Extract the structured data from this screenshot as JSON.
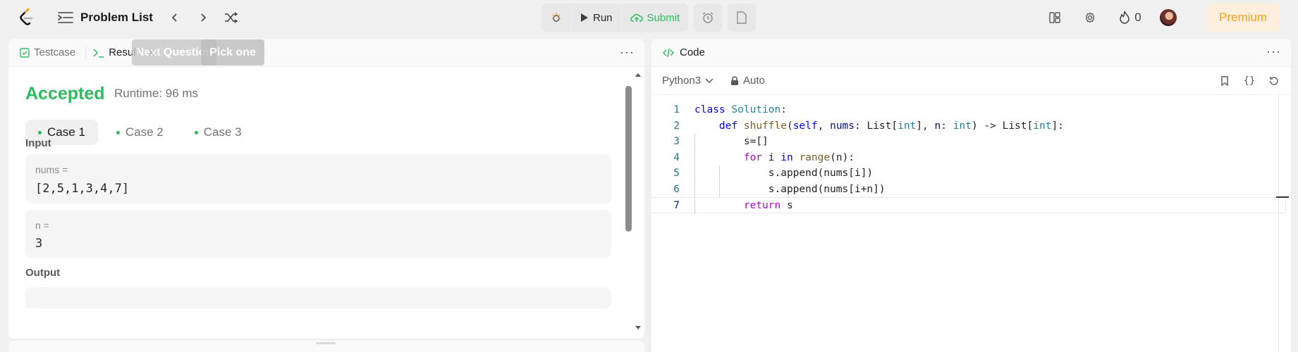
{
  "nav": {
    "problem_list": "Problem List",
    "run": "Run",
    "submit": "Submit",
    "fire_count": "0",
    "premium": "Premium"
  },
  "left": {
    "tabs": [
      "Testcase",
      "Result"
    ],
    "overlay_buttons": [
      "Next Question",
      "Pick one"
    ],
    "status": "Accepted",
    "runtime": "Runtime: 96 ms",
    "cases": [
      "Case 1",
      "Case 2",
      "Case 3"
    ],
    "input_label": "Input",
    "inputs": [
      {
        "name": "nums =",
        "value": "[2,5,1,3,4,7]"
      },
      {
        "name": "n =",
        "value": "3"
      }
    ],
    "output_label": "Output"
  },
  "right": {
    "title": "Code",
    "language": "Python3",
    "mode": "Auto",
    "line_numbers": [
      "1",
      "2",
      "3",
      "4",
      "5",
      "6",
      "7"
    ]
  },
  "colors": {
    "accent_green": "#2cbb5d",
    "premium_orange": "#ffa116"
  },
  "icons": [
    "leetcode-logo",
    "list-icon",
    "chevron-left-icon",
    "chevron-right-icon",
    "shuffle-icon",
    "debug-icon",
    "play-icon",
    "upload-cloud-icon",
    "alarm-icon",
    "note-icon",
    "layout-icon",
    "gear-icon",
    "fire-icon",
    "lock-icon",
    "bookmark-icon",
    "braces-icon",
    "reset-icon",
    "more-icon"
  ]
}
